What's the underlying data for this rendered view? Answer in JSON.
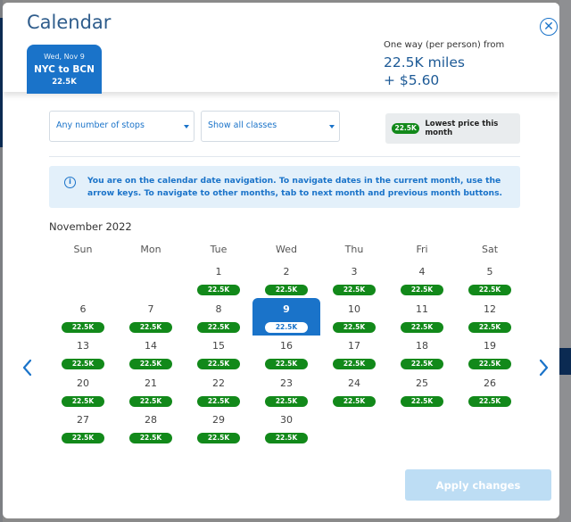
{
  "modal": {
    "title": "Calendar",
    "close_icon": "close-circle-icon"
  },
  "selected_trip": {
    "date": "Wed, Nov 9",
    "route": "NYC to BCN",
    "price": "22.5K"
  },
  "fare_summary": {
    "label": "One way (per person) from",
    "miles": "22.5K miles",
    "cash": "+ $5.60"
  },
  "filters": {
    "stops": {
      "selected": "Any number of stops"
    },
    "classes": {
      "selected": "Show all classes"
    }
  },
  "legend": {
    "pill": "22.5K",
    "text": "Lowest price this month",
    "color": "#12891a"
  },
  "info_banner": {
    "icon": "info-icon",
    "text": "You are on the calendar date navigation. To navigate dates in the current month, use the arrow keys. To navigate to other months, tab to next month and previous month buttons."
  },
  "calendar": {
    "month_label": "November 2022",
    "weekdays": [
      "Sun",
      "Mon",
      "Tue",
      "Wed",
      "Thu",
      "Fri",
      "Sat"
    ],
    "first_weekday_index": 2,
    "selected_day": 9,
    "days": [
      {
        "day": "1",
        "price": "22.5K"
      },
      {
        "day": "2",
        "price": "22.5K"
      },
      {
        "day": "3",
        "price": "22.5K"
      },
      {
        "day": "4",
        "price": "22.5K"
      },
      {
        "day": "5",
        "price": "22.5K"
      },
      {
        "day": "6",
        "price": "22.5K"
      },
      {
        "day": "7",
        "price": "22.5K"
      },
      {
        "day": "8",
        "price": "22.5K"
      },
      {
        "day": "9",
        "price": "22.5K"
      },
      {
        "day": "10",
        "price": "22.5K"
      },
      {
        "day": "11",
        "price": "22.5K"
      },
      {
        "day": "12",
        "price": "22.5K"
      },
      {
        "day": "13",
        "price": "22.5K"
      },
      {
        "day": "14",
        "price": "22.5K"
      },
      {
        "day": "15",
        "price": "22.5K"
      },
      {
        "day": "16",
        "price": "22.5K"
      },
      {
        "day": "17",
        "price": "22.5K"
      },
      {
        "day": "18",
        "price": "22.5K"
      },
      {
        "day": "19",
        "price": "22.5K"
      },
      {
        "day": "20",
        "price": "22.5K"
      },
      {
        "day": "21",
        "price": "22.5K"
      },
      {
        "day": "22",
        "price": "22.5K"
      },
      {
        "day": "23",
        "price": "22.5K"
      },
      {
        "day": "24",
        "price": "22.5K"
      },
      {
        "day": "25",
        "price": "22.5K"
      },
      {
        "day": "26",
        "price": "22.5K"
      },
      {
        "day": "27",
        "price": "22.5K"
      },
      {
        "day": "28",
        "price": "22.5K"
      },
      {
        "day": "29",
        "price": "22.5K"
      },
      {
        "day": "30",
        "price": "22.5K"
      }
    ],
    "prev_icon": "chevron-left-icon",
    "next_icon": "chevron-right-icon"
  },
  "footer": {
    "apply_label": "Apply changes"
  },
  "colors": {
    "accent": "#1a73c9",
    "price_pill": "#12891a",
    "info_bg": "#e3f0fa",
    "apply_disabled": "#bdddf4"
  }
}
